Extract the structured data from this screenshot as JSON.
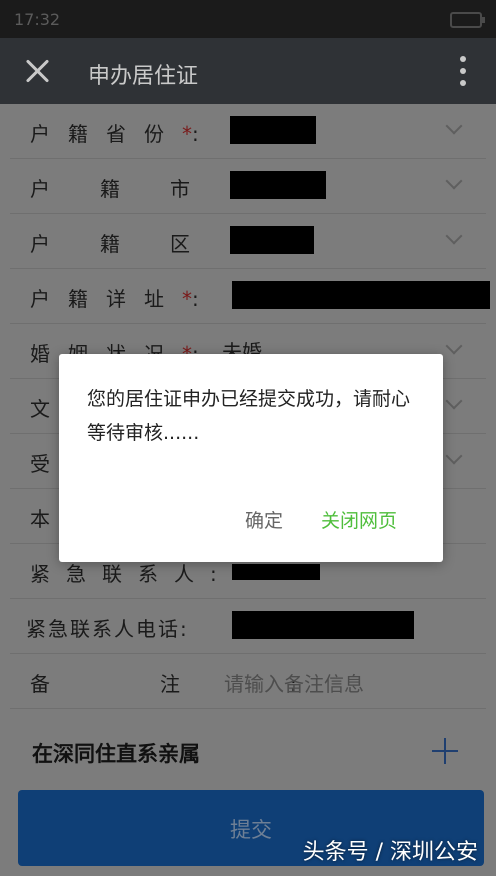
{
  "status": {
    "time": "17:32"
  },
  "appbar": {
    "title": "申办居住证"
  },
  "form": {
    "rows": [
      {
        "label": "户籍省份",
        "required": "*",
        "suffix": ":"
      },
      {
        "label": "户籍市",
        "required": "*",
        "suffix": ":"
      },
      {
        "label": "户籍区",
        "required": "*",
        "suffix": ":"
      },
      {
        "label": "户籍详址",
        "required": "*",
        "suffix": ":"
      },
      {
        "label": "婚姻状况",
        "required": "*",
        "suffix": ":",
        "value": "未婚"
      },
      {
        "label": "文"
      },
      {
        "label": "受"
      },
      {
        "label": "本"
      },
      {
        "label": "紧急联系人",
        "suffix": ":"
      },
      {
        "label": "紧急联系人电话",
        "suffix": ":"
      },
      {
        "label": "备注",
        "suffix": ":",
        "placeholder": "请输入备注信息"
      }
    ]
  },
  "section": {
    "title": "在深同住直系亲属"
  },
  "submit": {
    "label": "提交"
  },
  "dialog": {
    "message": "您的居住证申办已经提交成功，请耐心等待审核......",
    "confirm": "确定",
    "close_page": "关闭网页"
  },
  "watermark": "头条号 / 深圳公安"
}
